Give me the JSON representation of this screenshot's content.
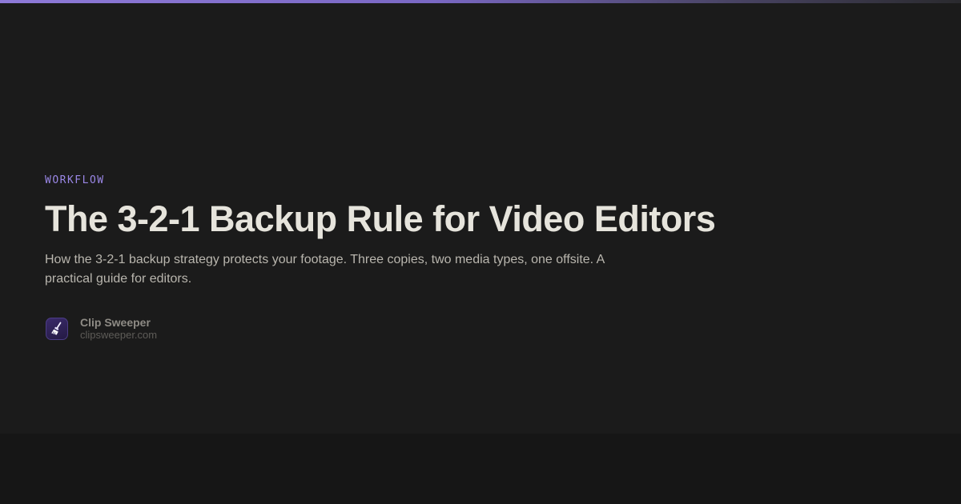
{
  "accent": {
    "bar_start": "#8e7ad8",
    "bar_end": "#2a2a2e",
    "category_color": "#9a87e6"
  },
  "article": {
    "category": "WORKFLOW",
    "title": "The 3-2-1 Backup Rule for Video Editors",
    "description": "How the 3-2-1 backup strategy protects your footage. Three copies, two media types, one offsite. A practical guide for editors."
  },
  "author": {
    "icon": "broom-icon",
    "name": "Clip Sweeper",
    "site": "clipsweeper.com"
  }
}
